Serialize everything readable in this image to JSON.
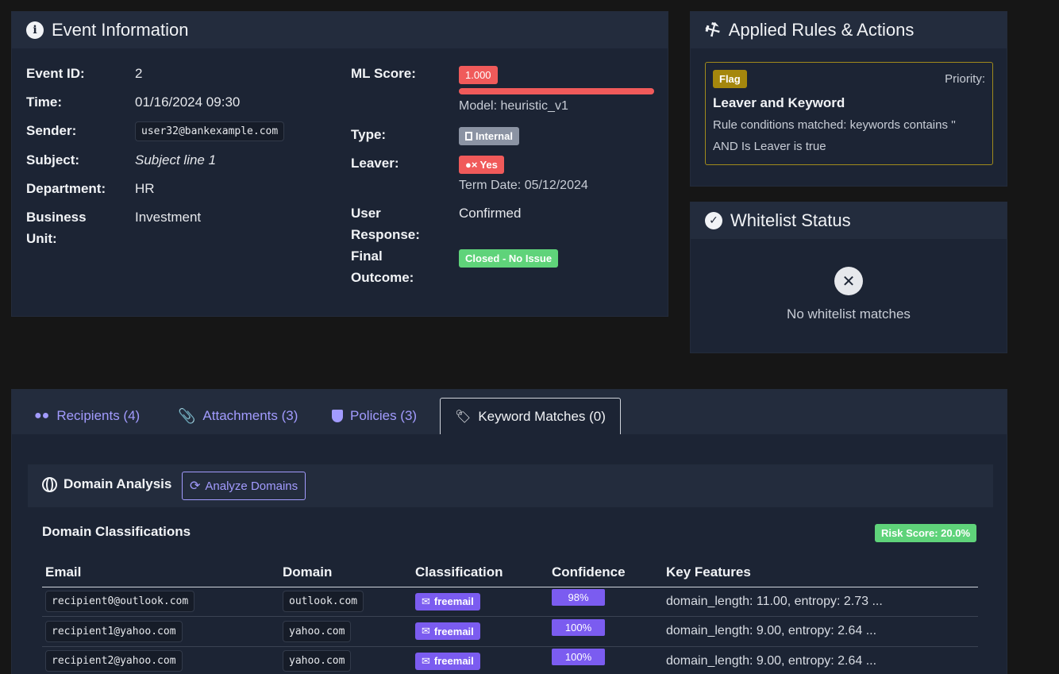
{
  "event_info": {
    "title": "Event Information",
    "event_id_label": "Event ID:",
    "event_id": "2",
    "time_label": "Time:",
    "time": "01/16/2024 09:30",
    "sender_label": "Sender:",
    "sender": "user32@bankexample.com",
    "subject_label": "Subject:",
    "subject": "Subject line 1",
    "department_label": "Department:",
    "department": "HR",
    "business_unit_label_1": "Business",
    "business_unit_label_2": "Unit:",
    "business_unit": "Investment",
    "ml_score_label": "ML Score:",
    "ml_score": "1.000",
    "ml_score_fraction": 1.0,
    "model": "Model: heuristic_v1",
    "type_label": "Type:",
    "type": "Internal",
    "leaver_label": "Leaver:",
    "leaver": "Yes",
    "term_date": "Term Date: 05/12/2024",
    "user_response_label_1": "User",
    "user_response_label_2": "Response:",
    "user_response": "Confirmed",
    "final_outcome_label_1": "Final",
    "final_outcome_label_2": "Outcome:",
    "final_outcome": "Closed - No Issue"
  },
  "rules": {
    "title": "Applied Rules & Actions",
    "action_badge": "Flag",
    "priority_label": "Priority:",
    "rule_name": "Leaver and Keyword",
    "rule_desc_1": "Rule conditions matched: keywords contains ''",
    "rule_desc_2": "AND Is Leaver is true"
  },
  "whitelist": {
    "title": "Whitelist Status",
    "empty_text": "No whitelist matches"
  },
  "tabs": [
    {
      "label": "Recipients (4)",
      "icon": "users-icon"
    },
    {
      "label": "Attachments (3)",
      "icon": "paperclip-icon"
    },
    {
      "label": "Policies (3)",
      "icon": "shield-icon"
    },
    {
      "label": "Keyword Matches (0)",
      "icon": "tags-icon",
      "active": true
    }
  ],
  "domain_analysis": {
    "title": "Domain Analysis",
    "analyze_button": "Analyze Domains",
    "classifications_title": "Domain Classifications",
    "risk_score": "Risk Score: 20.0%",
    "columns": [
      "Email",
      "Domain",
      "Classification",
      "Confidence",
      "Key Features"
    ],
    "rows": [
      {
        "email": "recipient0@outlook.com",
        "domain": "outlook.com",
        "classification": "freemail",
        "confidence": "98%",
        "features": "domain_length: 11.00, entropy: 2.73 ..."
      },
      {
        "email": "recipient1@yahoo.com",
        "domain": "yahoo.com",
        "classification": "freemail",
        "confidence": "100%",
        "features": "domain_length: 9.00, entropy: 2.64 ..."
      },
      {
        "email": "recipient2@yahoo.com",
        "domain": "yahoo.com",
        "classification": "freemail",
        "confidence": "100%",
        "features": "domain_length: 9.00, entropy: 2.64 ..."
      }
    ]
  },
  "colors": {
    "background": "#161616",
    "card": "#1c2434",
    "card_header": "#232c3d",
    "accent_purple": "#7b5cf0",
    "link_purple": "#a29bfe",
    "danger": "#f05a5a",
    "success": "#5fd37a",
    "warning_border": "#a08a1c",
    "flag_badge": "#a5870d",
    "neutral_badge": "#8b93a3"
  }
}
